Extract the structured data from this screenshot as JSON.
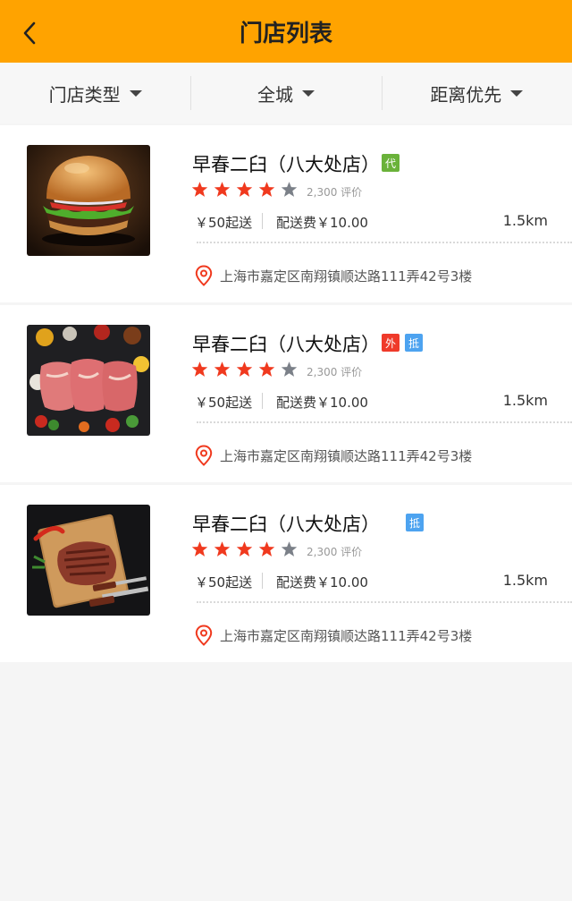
{
  "header": {
    "title": "门店列表",
    "back_icon": "chevron-left-icon",
    "bg_color": "#ffa300"
  },
  "filters": [
    {
      "label": "门店类型",
      "icon": "caret-down-icon"
    },
    {
      "label": "全城",
      "icon": "caret-down-icon"
    },
    {
      "label": "距离优先",
      "icon": "caret-down-icon"
    }
  ],
  "stores": [
    {
      "name": "早春二臼（八大处店）",
      "image": "burger-photo",
      "badges": [
        {
          "text": "代",
          "color": "green"
        }
      ],
      "rating": 4,
      "reviews": "2,300 评价",
      "min_order": "￥50起送",
      "delivery_fee": "配送费￥10.00",
      "distance": "1.5km",
      "address": "上海市嘉定区南翔镇顺达路111弄42号3楼"
    },
    {
      "name": "早春二臼（八大处店）",
      "image": "raw-meat-photo",
      "badges": [
        {
          "text": "外",
          "color": "red"
        },
        {
          "text": "抵",
          "color": "blue"
        }
      ],
      "rating": 4,
      "reviews": "2,300 评价",
      "min_order": "￥50起送",
      "delivery_fee": "配送费￥10.00",
      "distance": "1.5km",
      "address": "上海市嘉定区南翔镇顺达路111弄42号3楼"
    },
    {
      "name": "早春二臼（八大处店）",
      "image": "steak-photo",
      "badges": [
        {
          "text": "抵",
          "color": "blue"
        }
      ],
      "rating": 4,
      "reviews": "2,300 评价",
      "min_order": "￥50起送",
      "delivery_fee": "配送费￥10.00",
      "distance": "1.5km",
      "address": "上海市嘉定区南翔镇顺达路111弄42号3楼"
    }
  ],
  "colors": {
    "star_on": "#f0391e",
    "star_off": "#7b8088",
    "pin": "#f0391e"
  }
}
